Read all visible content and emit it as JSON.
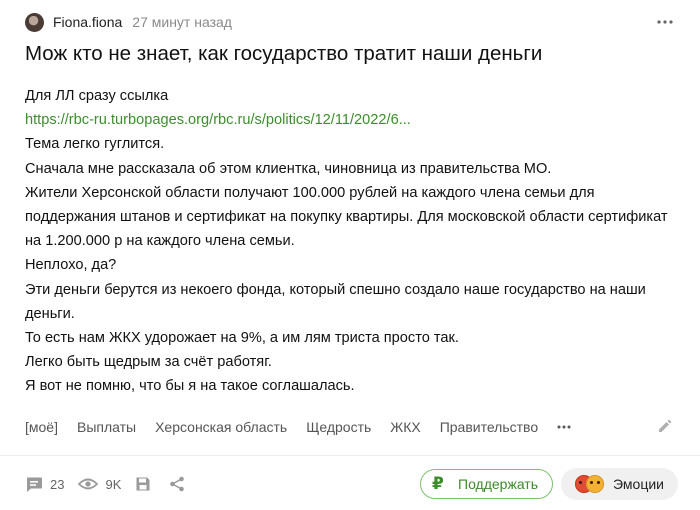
{
  "post": {
    "author": "Fiona.fiona",
    "time": "27 минут назад",
    "title": "Мож кто не знает, как государство тратит наши деньги",
    "body": {
      "line1": "Для ЛЛ сразу ссылка",
      "link": "https://rbc-ru.turbopages.org/rbc.ru/s/politics/12/11/2022/6...",
      "line2": "Тема легко гуглится.",
      "line3": "Сначала мне рассказала об этом клиентка, чиновница из правительства МО.",
      "line4": "Жители Херсонской области получают 100.000 рублей на каждого члена семьи для поддержания штанов и сертификат на покупку квартиры. Для московской области сертификат на 1.200.000 р на каждого члена семьи.",
      "line5": "Неплохо, да?",
      "line6": "Эти деньги берутся из некоего фонда, который спешно создало наше государство на наши деньги.",
      "line7": "То есть нам ЖКХ удорожает на 9%, а им лям триста просто так.",
      "line8": "Легко быть щедрым за счёт работяг.",
      "line9": "Я вот не помню, что бы я на такое соглашалась."
    },
    "tags": [
      "[моё]",
      "Выплаты",
      "Херсонская область",
      "Щедрость",
      "ЖКХ",
      "Правительство"
    ]
  },
  "footer": {
    "comments": "23",
    "views": "9K",
    "support_label": "Поддержать",
    "emotions_label": "Эмоции"
  },
  "icons": {
    "more": "more-dots-icon",
    "edit": "pencil-icon",
    "comments": "comment-icon",
    "views": "eye-icon",
    "save": "save-icon",
    "share": "share-icon",
    "support": "ruble-icon"
  },
  "colors": {
    "link": "#3b8f2a",
    "support_border": "#7cc26c",
    "muted": "#8a8a8a"
  }
}
